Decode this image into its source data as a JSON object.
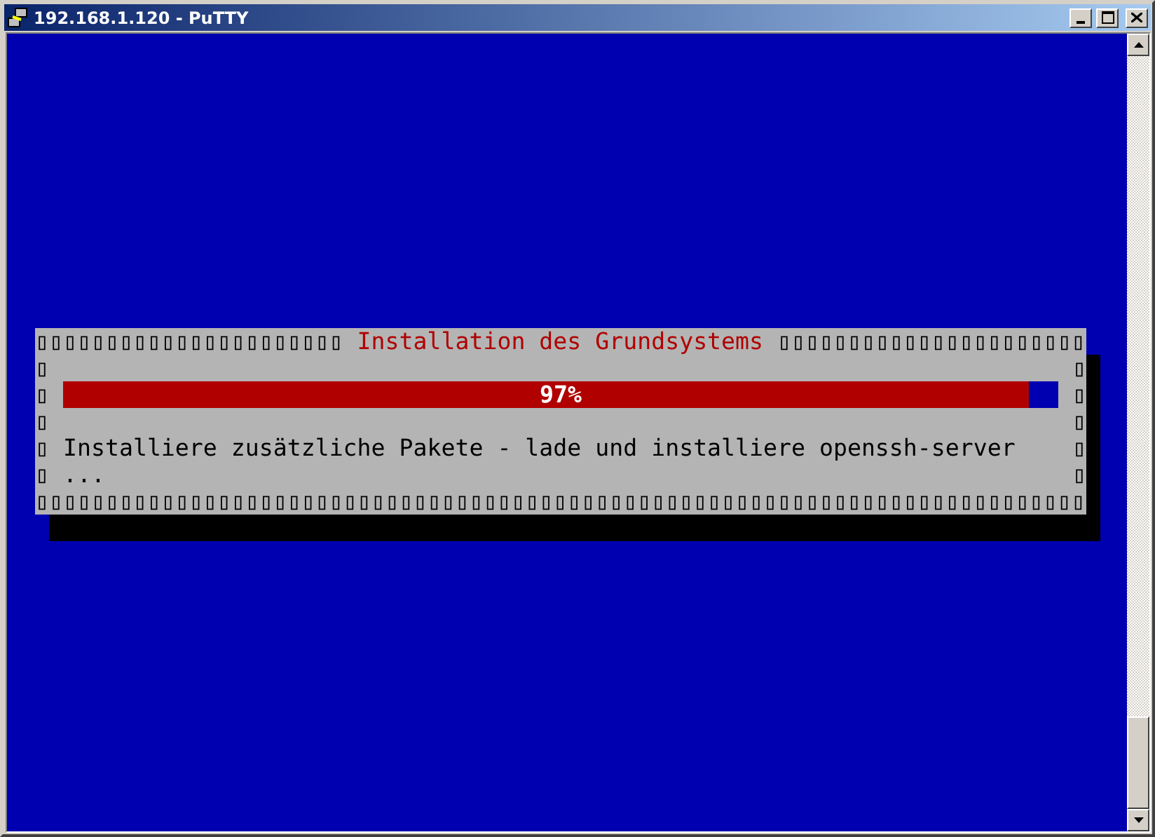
{
  "window": {
    "title": "192.168.1.120 - PuTTY"
  },
  "dialog": {
    "title": "Installation des Grundsystems",
    "title_border_left": "▯▯▯▯▯▯▯▯▯▯▯▯▯▯▯▯▯▯▯▯▯▯",
    "title_border_right": "▯▯▯▯▯▯▯▯▯▯▯▯▯▯▯▯▯▯▯▯▯▯",
    "rows": [
      {
        "kind": "blank",
        "border_left": "▯",
        "border_right": "▯"
      },
      {
        "kind": "progress",
        "border_left": "▯",
        "border_right": "▯",
        "level": 0.97,
        "reading": "97%"
      },
      {
        "kind": "blank",
        "border_left": "▯",
        "border_right": "▯"
      },
      {
        "kind": "text",
        "border_left": "▯",
        "border_right": "▯",
        "text": "Installiere zusätzliche Pakete - lade und installiere openssh-server"
      },
      {
        "kind": "text",
        "border_left": "▯",
        "border_right": "▯",
        "text": "..."
      }
    ],
    "bottom_border": "▯▯▯▯▯▯▯▯▯▯▯▯▯▯▯▯▯▯▯▯▯▯▯▯▯▯▯▯▯▯▯▯▯▯▯▯▯▯▯▯▯▯▯▯▯▯▯▯▯▯▯▯▯▯▯▯▯▯▯▯▯▯▯▯▯▯▯▯▯▯▯▯▯▯▯"
  }
}
